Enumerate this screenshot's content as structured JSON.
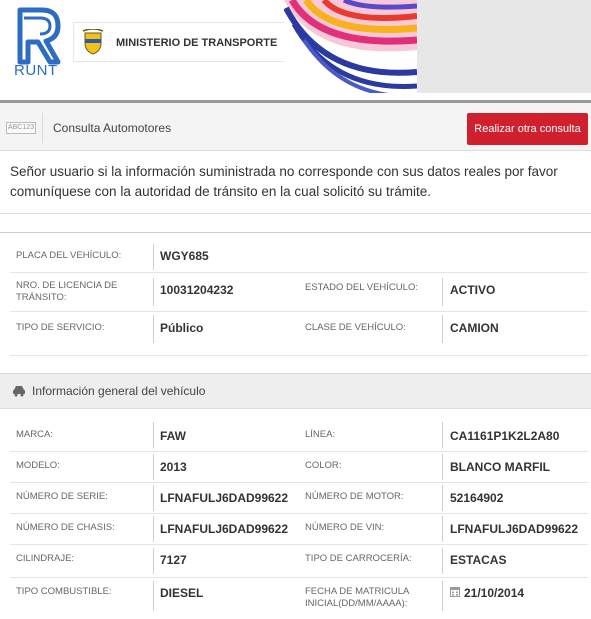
{
  "header": {
    "runt_label": "RUNT",
    "ministry_label": "MINISTERIO DE TRANSPORTE"
  },
  "toolbar": {
    "plate_icon_text": "ABC123",
    "title": "Consulta Automotores",
    "button_label": "Realizar otra consulta",
    "button_color": "#d0202e"
  },
  "notice": "Señor usuario si la información suministrada no corresponde con sus datos reales por favor comuníquese con la autoridad de tránsito en la cual solicitó su trámite.",
  "vehicle_summary": {
    "placa_label": "PLACA DEL VEHÍCULO:",
    "placa_value": "WGY685",
    "licencia_label": "NRO. DE LICENCIA DE TRÁNSITO:",
    "licencia_value": "10031204232",
    "estado_label": "ESTADO DEL VEHÍCULO:",
    "estado_value": "ACTIVO",
    "servicio_label": "TIPO DE SERVICIO:",
    "servicio_value": "Público",
    "clase_label": "CLASE DE VEHÍCULO:",
    "clase_value": "CAMION"
  },
  "general_section": {
    "title": "Información general del vehículo",
    "icon": "car-icon"
  },
  "general_info": {
    "marca_label": "MARCA:",
    "marca_value": "FAW",
    "linea_label": "LÍNEA:",
    "linea_value": "CA1161P1K2L2A80",
    "modelo_label": "MODELO:",
    "modelo_value": "2013",
    "color_label": "COLOR:",
    "color_value": "BLANCO MARFIL",
    "serie_label": "NÚMERO DE SERIE:",
    "serie_value": "LFNAFULJ6DAD99622",
    "motor_label": "NÚMERO DE MOTOR:",
    "motor_value": "52164902",
    "chasis_label": "NÚMERO DE CHASIS:",
    "chasis_value": "LFNAFULJ6DAD99622",
    "vin_label": "NÚMERO DE VIN:",
    "vin_value": "LFNAFULJ6DAD99622",
    "cilindraje_label": "CILINDRAJE:",
    "cilindraje_value": "7127",
    "carroceria_label": "TIPO DE CARROCERÍA:",
    "carroceria_value": "ESTACAS",
    "combustible_label": "TIPO COMBUSTIBLE:",
    "combustible_value": "DIESEL",
    "matricula_label": "FECHA DE MATRICULA INICIAL(DD/MM/AAAA):",
    "matricula_value": "21/10/2014"
  }
}
